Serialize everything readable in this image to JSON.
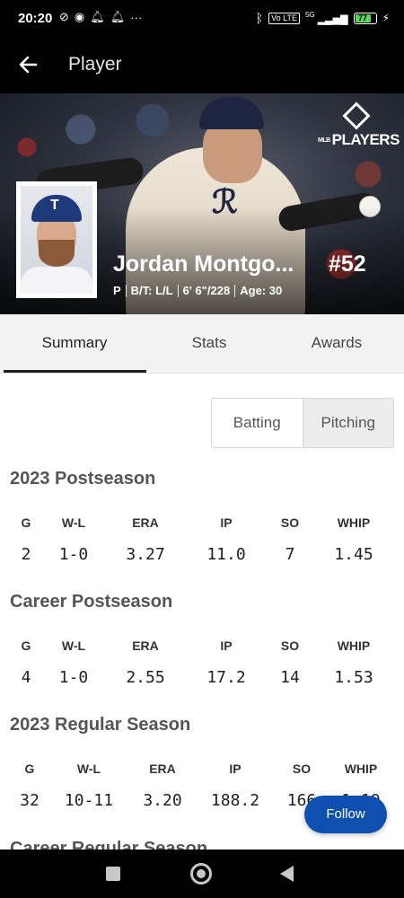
{
  "status_bar": {
    "time": "20:20",
    "icons": [
      "muted-notification-icon",
      "messenger-icon",
      "bell-icon",
      "bell-icon",
      "more-icon"
    ],
    "right_icons": [
      "bluetooth-icon",
      "volte-icon",
      "5g-signal-icon",
      "battery-icon",
      "charging-icon"
    ],
    "network_label": "5G",
    "volte_label": "Vo LTE",
    "battery": "77"
  },
  "app_bar": {
    "title": "Player"
  },
  "hero": {
    "brand_prefix": "MLB",
    "brand": "PLAYERS",
    "player_name": "Jordan Montgo...",
    "number": "#52",
    "info": {
      "position": "P",
      "bats_throws": "B/T: L/L",
      "height_weight": "6' 6\"/228",
      "age": "Age: 30"
    },
    "headshot_cap_letter": "T"
  },
  "tabs": [
    {
      "label": "Summary",
      "active": true
    },
    {
      "label": "Stats",
      "active": false
    },
    {
      "label": "Awards",
      "active": false
    }
  ],
  "toggle": {
    "batting": "Batting",
    "pitching": "Pitching",
    "selected": "Pitching"
  },
  "sections": [
    {
      "title": "2023 Postseason",
      "headers": [
        "G",
        "W-L",
        "ERA",
        "IP",
        "SO",
        "WHIP"
      ],
      "values": [
        "2",
        "1-0",
        "3.27",
        "11.0",
        "7",
        "1.45"
      ]
    },
    {
      "title": "Career Postseason",
      "headers": [
        "G",
        "W-L",
        "ERA",
        "IP",
        "SO",
        "WHIP"
      ],
      "values": [
        "4",
        "1-0",
        "2.55",
        "17.2",
        "14",
        "1.53"
      ]
    },
    {
      "title": "2023 Regular Season",
      "headers": [
        "G",
        "W-L",
        "ERA",
        "IP",
        "SO",
        "WHIP"
      ],
      "values": [
        "32",
        "10-11",
        "3.20",
        "188.2",
        "166",
        "1.19"
      ]
    },
    {
      "title": "Career Regular Season"
    }
  ],
  "follow_button": "Follow",
  "colors": {
    "accent": "#0f4fb0",
    "battery": "#5cd65c"
  }
}
